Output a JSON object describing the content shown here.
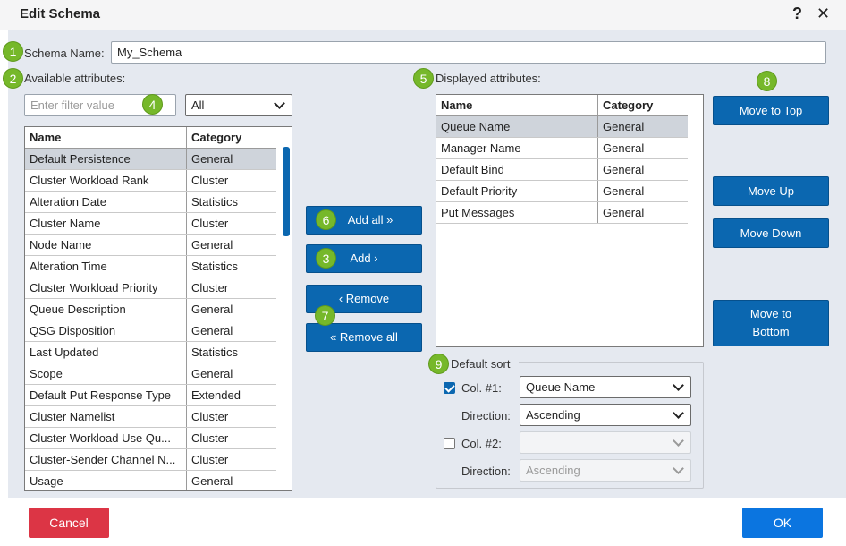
{
  "window": {
    "title": "Edit Schema",
    "help_glyph": "?",
    "close_glyph": "✕"
  },
  "schema_name": {
    "label": "Schema Name:",
    "value": "My_Schema"
  },
  "available": {
    "label": "Available attributes:",
    "filter_placeholder": "Enter filter value",
    "filter_scope": "All",
    "columns": [
      "Name",
      "Category"
    ],
    "rows": [
      [
        "Default Persistence",
        "General"
      ],
      [
        "Cluster Workload Rank",
        "Cluster"
      ],
      [
        "Alteration Date",
        "Statistics"
      ],
      [
        "Cluster Name",
        "Cluster"
      ],
      [
        "Node Name",
        "General"
      ],
      [
        "Alteration Time",
        "Statistics"
      ],
      [
        "Cluster Workload Priority",
        "Cluster"
      ],
      [
        "Queue Description",
        "General"
      ],
      [
        "QSG Disposition",
        "General"
      ],
      [
        "Last Updated",
        "Statistics"
      ],
      [
        "Scope",
        "General"
      ],
      [
        "Default Put Response Type",
        "Extended"
      ],
      [
        "Cluster Namelist",
        "Cluster"
      ],
      [
        "Cluster Workload Use Qu...",
        "Cluster"
      ],
      [
        "Cluster-Sender Channel N...",
        "Cluster"
      ],
      [
        "Usage",
        "General"
      ]
    ]
  },
  "transfer": {
    "add_all": "Add all »",
    "add": "Add ›",
    "remove": "‹ Remove",
    "remove_all": "« Remove all"
  },
  "displayed": {
    "label": "Displayed attributes:",
    "columns": [
      "Name",
      "Category"
    ],
    "rows": [
      [
        "Queue Name",
        "General"
      ],
      [
        "Manager Name",
        "General"
      ],
      [
        "Default Bind",
        "General"
      ],
      [
        "Default Priority",
        "General"
      ],
      [
        "Put Messages",
        "General"
      ]
    ]
  },
  "order": {
    "move_top": "Move to Top",
    "move_up": "Move Up",
    "move_down": "Move Down",
    "move_bottom": "Move to Bottom"
  },
  "sort": {
    "legend": "Default sort",
    "col1": {
      "checked": true,
      "label": "Col. #1:",
      "value": "Queue Name",
      "direction_label": "Direction:",
      "direction": "Ascending"
    },
    "col2": {
      "checked": false,
      "label": "Col. #2:",
      "value": "",
      "direction_label": "Direction:",
      "direction": "Ascending"
    }
  },
  "footer": {
    "cancel": "Cancel",
    "ok": "OK"
  },
  "callouts": [
    "1",
    "2",
    "3",
    "4",
    "5",
    "6",
    "7",
    "8",
    "9"
  ],
  "colors": {
    "primary": "#0b67b0",
    "danger": "#dc3545",
    "ok": "#0b75e0",
    "callout": "#76b82a",
    "panel": "#e5e9f0"
  }
}
